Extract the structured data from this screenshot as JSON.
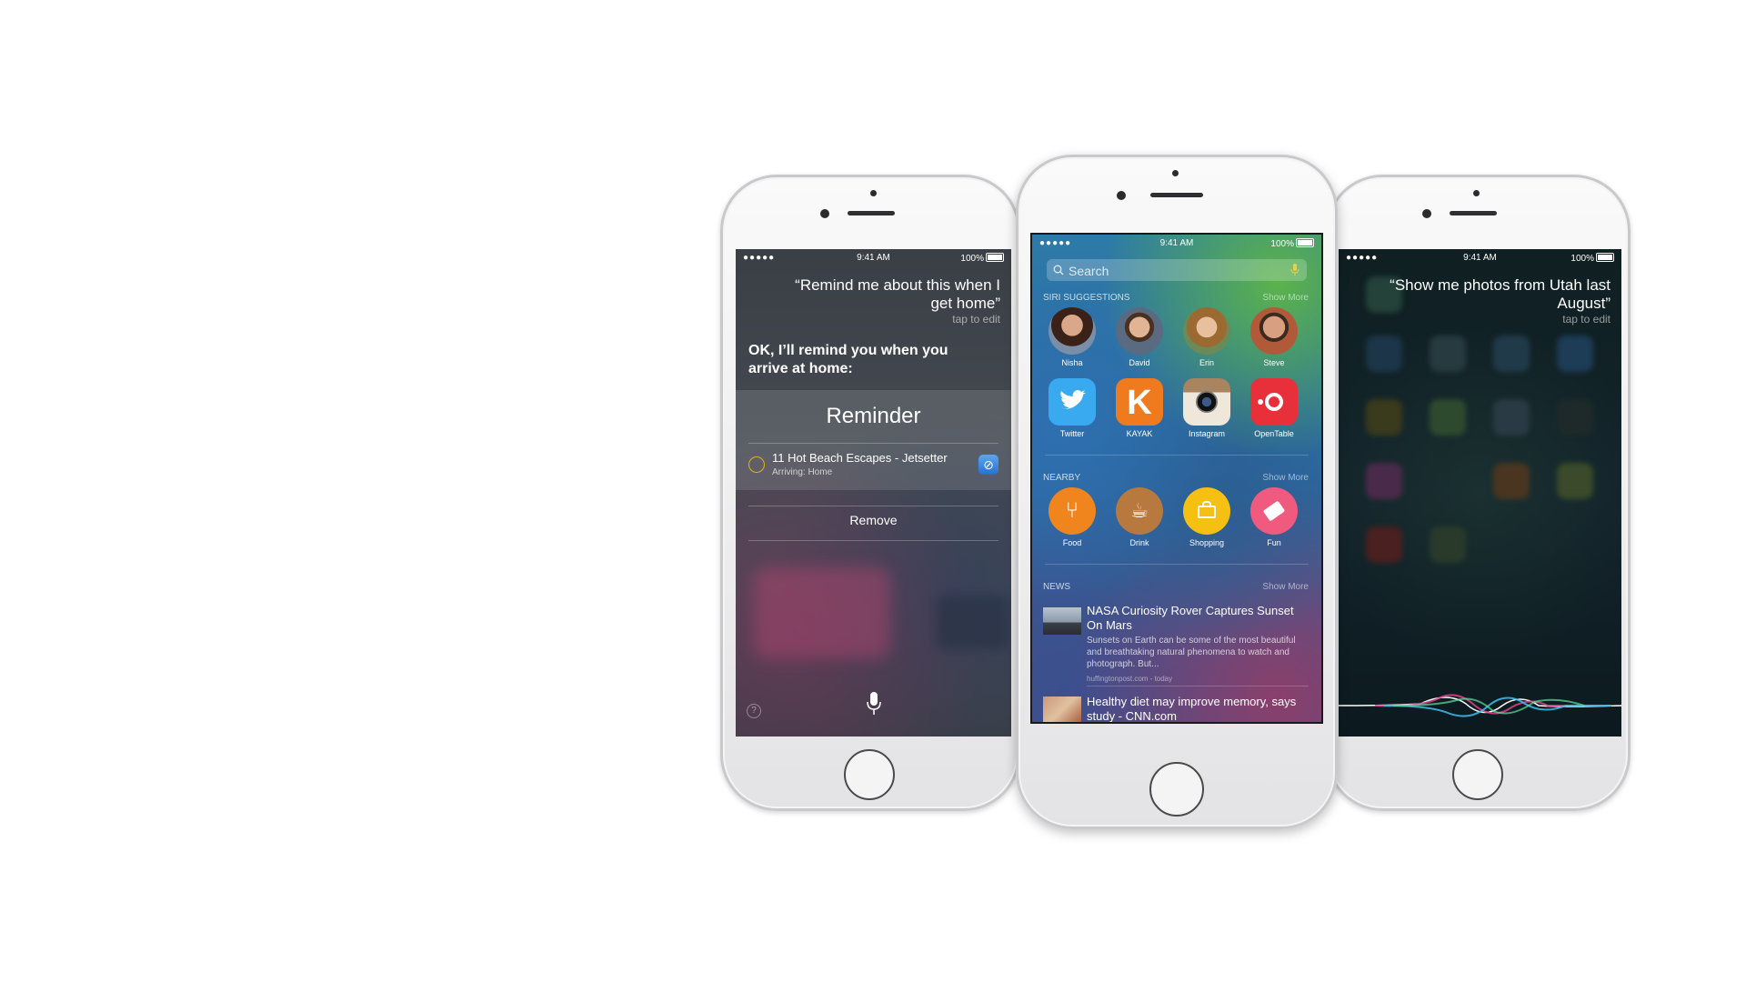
{
  "status": {
    "signal": "●●●●●",
    "time": "9:41 AM",
    "battery": "100%"
  },
  "left_screen": {
    "query": "“Remind me about this when I get home”",
    "tap_to_edit": "tap to edit",
    "answer": "OK, I’ll remind you when you arrive at home:",
    "card_title": "Reminder",
    "reminder_title": "11 Hot Beach Escapes - Jetsetter",
    "reminder_sub": "Arriving: Home",
    "remove_label": "Remove",
    "help_label": "?"
  },
  "center_screen": {
    "search_placeholder": "Search",
    "siri_suggestions_label": "SIRI SUGGESTIONS",
    "show_more": "Show More",
    "contacts": [
      "Nisha",
      "David",
      "Erin",
      "Steve"
    ],
    "apps": [
      "Twitter",
      "KAYAK",
      "Instagram",
      "OpenTable"
    ],
    "nearby_label": "NEARBY",
    "nearby": [
      "Food",
      "Drink",
      "Shopping",
      "Fun"
    ],
    "news_label": "NEWS",
    "news": [
      {
        "title": "NASA Curiosity Rover Captures Sunset On Mars",
        "body": "Sunsets on Earth can be some of the most beautiful and breathtaking natural phenomena to watch and photograph. But...",
        "source": "huffingtonpost.com - today"
      },
      {
        "title": "Healthy diet may improve memory, says study - CNN.com"
      }
    ]
  },
  "right_screen": {
    "query": "“Show me photos from Utah last August”",
    "tap_to_edit": "tap to edit"
  },
  "colors": {
    "food": "#f0851e",
    "drink": "#b8793e",
    "shopping": "#f5c012",
    "fun": "#f05a7e",
    "twitter": "#3aaaf0",
    "kayak": "#f07a1e",
    "opentable": "#e8303a"
  }
}
